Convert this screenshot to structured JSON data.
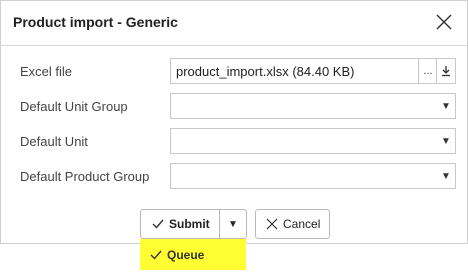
{
  "dialog": {
    "title": "Product import - Generic",
    "close_icon": "close-icon"
  },
  "fields": {
    "excel_file": {
      "label": "Excel file",
      "value": "product_import.xlsx (84.40 KB)",
      "browse_label": "...",
      "download_icon": "download-icon"
    },
    "default_unit_group": {
      "label": "Default Unit Group",
      "value": ""
    },
    "default_unit": {
      "label": "Default Unit",
      "value": ""
    },
    "default_product_group": {
      "label": "Default Product Group",
      "value": ""
    }
  },
  "buttons": {
    "submit": "Submit",
    "dropdown_caret": "▼",
    "cancel": "Cancel"
  },
  "menu": {
    "queue": "Queue",
    "highlight_color": "#ffff33"
  }
}
